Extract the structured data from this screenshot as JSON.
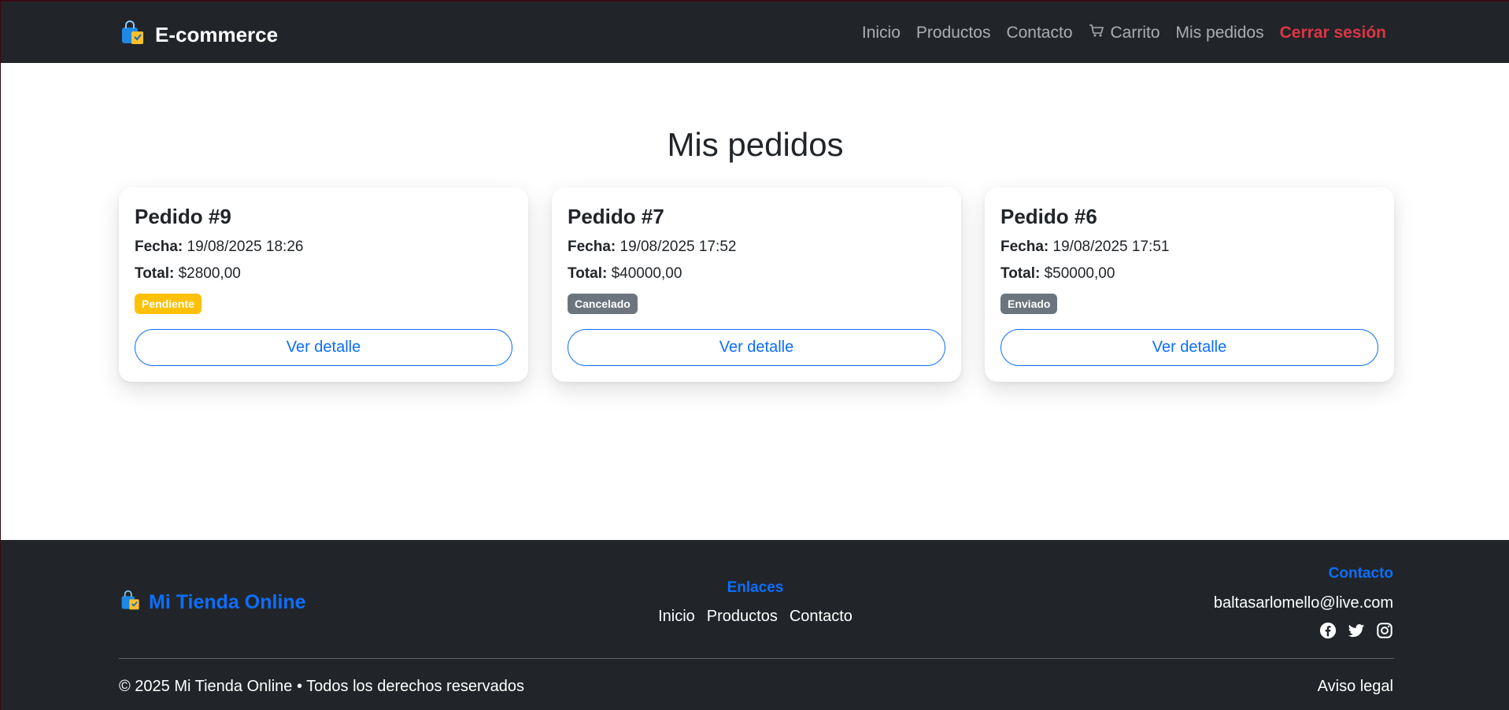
{
  "navbar": {
    "brand": "E-commerce",
    "links": [
      "Inicio",
      "Productos",
      "Contacto"
    ],
    "cart_label": "Carrito",
    "orders_label": "Mis pedidos",
    "logout_label": "Cerrar sesión"
  },
  "main": {
    "title": "Mis pedidos",
    "date_label": "Fecha:",
    "total_label": "Total:",
    "detail_button": "Ver detalle",
    "orders": [
      {
        "title": "Pedido #9",
        "date": "19/08/2025 18:26",
        "total": "$2800,00",
        "status": "Pendiente",
        "status_color": "#ffc107"
      },
      {
        "title": "Pedido #7",
        "date": "19/08/2025 17:52",
        "total": "$40000,00",
        "status": "Cancelado",
        "status_color": "#6c757d"
      },
      {
        "title": "Pedido #6",
        "date": "19/08/2025 17:51",
        "total": "$50000,00",
        "status": "Enviado",
        "status_color": "#6c757d"
      }
    ]
  },
  "footer": {
    "brand": "Mi Tienda Online",
    "links_title": "Enlaces",
    "links": [
      "Inicio",
      "Productos",
      "Contacto"
    ],
    "contact_title": "Contacto",
    "email": "baltasarlomello@live.com",
    "socials": [
      "facebook-icon",
      "twitter-icon",
      "instagram-icon"
    ],
    "copyright": "© 2025 Mi Tienda Online • Todos los derechos reservados",
    "legal": "Aviso legal"
  },
  "colors": {
    "dark": "#212529",
    "primary": "#0d6efd",
    "danger": "#dc3545",
    "warning": "#ffc107",
    "secondary": "#6c757d"
  }
}
